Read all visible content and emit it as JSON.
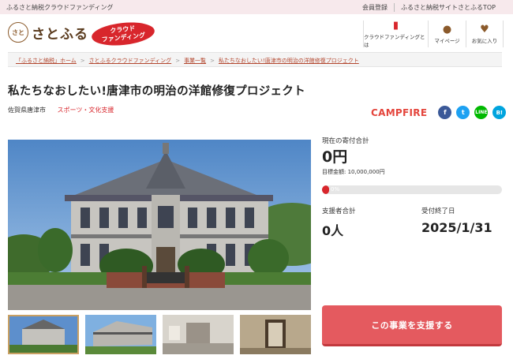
{
  "topbar": {
    "tagline": "ふるさと納税クラウドファンディング",
    "links": [
      "会員登録",
      "ふるさと納税サイトさとふるTOP"
    ]
  },
  "header": {
    "logo_mark": "さと",
    "logo_text": "さとふる",
    "badge_line1": "クラウド",
    "badge_line2": "ファンディング",
    "nav": [
      {
        "label": "クラウドファンディングとは",
        "icon": "book-icon"
      },
      {
        "label": "マイページ",
        "icon": "person-icon"
      },
      {
        "label": "お気に入り",
        "icon": "heart-icon"
      }
    ]
  },
  "breadcrumb": [
    "「ふるさと納税」ホーム",
    "さとふるクラウドファンディング",
    "事業一覧",
    "私たちなおしたい!唐津市の明治の洋館修復プロジェクト"
  ],
  "project": {
    "title": "私たちなおしたい!唐津市の明治の洋館修復プロジェクト",
    "prefecture": "佐賀県唐津市",
    "category": "スポーツ・文化支援",
    "partner": "CAMPFIRE"
  },
  "share": {
    "facebook": "f",
    "twitter": "t",
    "line": "LINE",
    "hatena": "B!"
  },
  "stats": {
    "total_label": "現在の寄付合計",
    "total_value": "0円",
    "goal_label": "目標金額: 10,000,000円",
    "progress_percent": 0,
    "progress_label": "0%",
    "supporters_label": "支援者合計",
    "supporters_value": "0人",
    "deadline_label": "受付終了日",
    "deadline_value": "2025/1/31"
  },
  "cta": {
    "support_label": "この事業を支援する"
  },
  "colors": {
    "accent_red": "#d8262c",
    "button": "#e45a5f",
    "topbar_bg": "#f7e9ec",
    "brand_brown": "#8b5a2b"
  }
}
